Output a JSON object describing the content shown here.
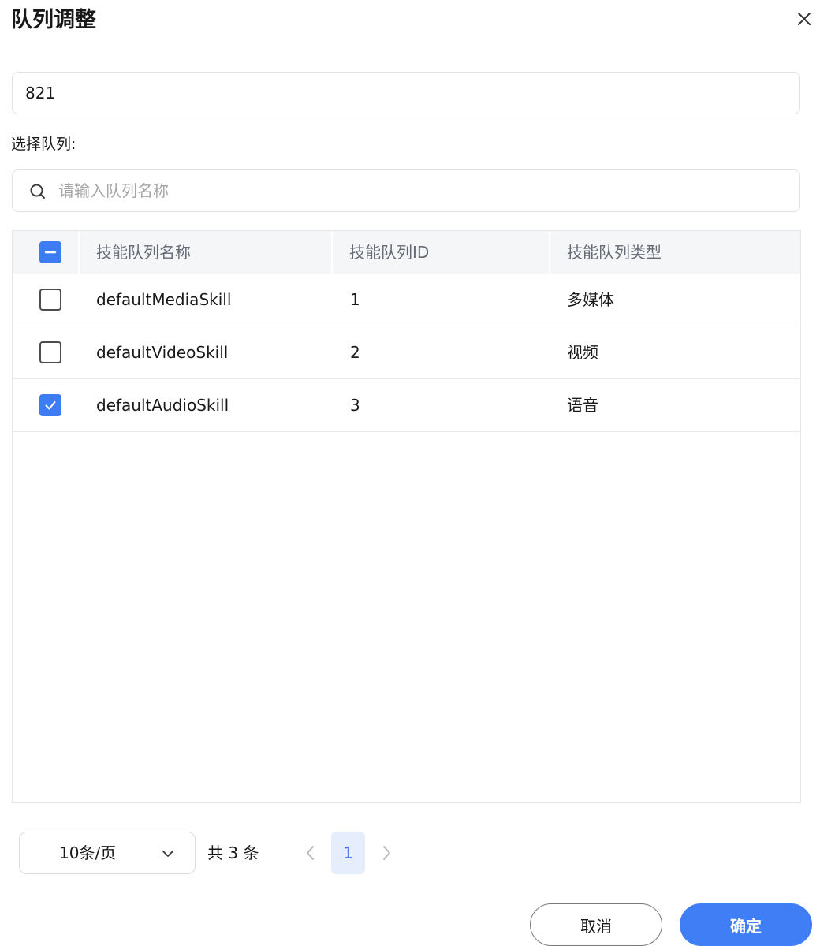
{
  "dialog": {
    "title": "队列调整",
    "close_icon": "close-icon"
  },
  "id_field": {
    "value": "821"
  },
  "select_queue": {
    "label": "选择队列:"
  },
  "search": {
    "icon": "search-icon",
    "placeholder": "请输入队列名称",
    "value": ""
  },
  "table": {
    "header_checkbox_state": "indeterminate",
    "columns": [
      "技能队列名称",
      "技能队列ID",
      "技能队列类型"
    ],
    "rows": [
      {
        "checked": false,
        "name": "defaultMediaSkill",
        "id": "1",
        "type": "多媒体"
      },
      {
        "checked": false,
        "name": "defaultVideoSkill",
        "id": "2",
        "type": "视频"
      },
      {
        "checked": true,
        "name": "defaultAudioSkill",
        "id": "3",
        "type": "语音"
      }
    ]
  },
  "pagination": {
    "page_size_label": "10条/页",
    "total_label": "共 3 条",
    "current_page": "1"
  },
  "footer": {
    "cancel_label": "取消",
    "ok_label": "确定"
  },
  "colors": {
    "primary": "#3f7ef5",
    "checkbox_checked": "#3f7cf4",
    "page_active_bg": "#e6edfc",
    "header_bg": "#f5f6f8"
  }
}
